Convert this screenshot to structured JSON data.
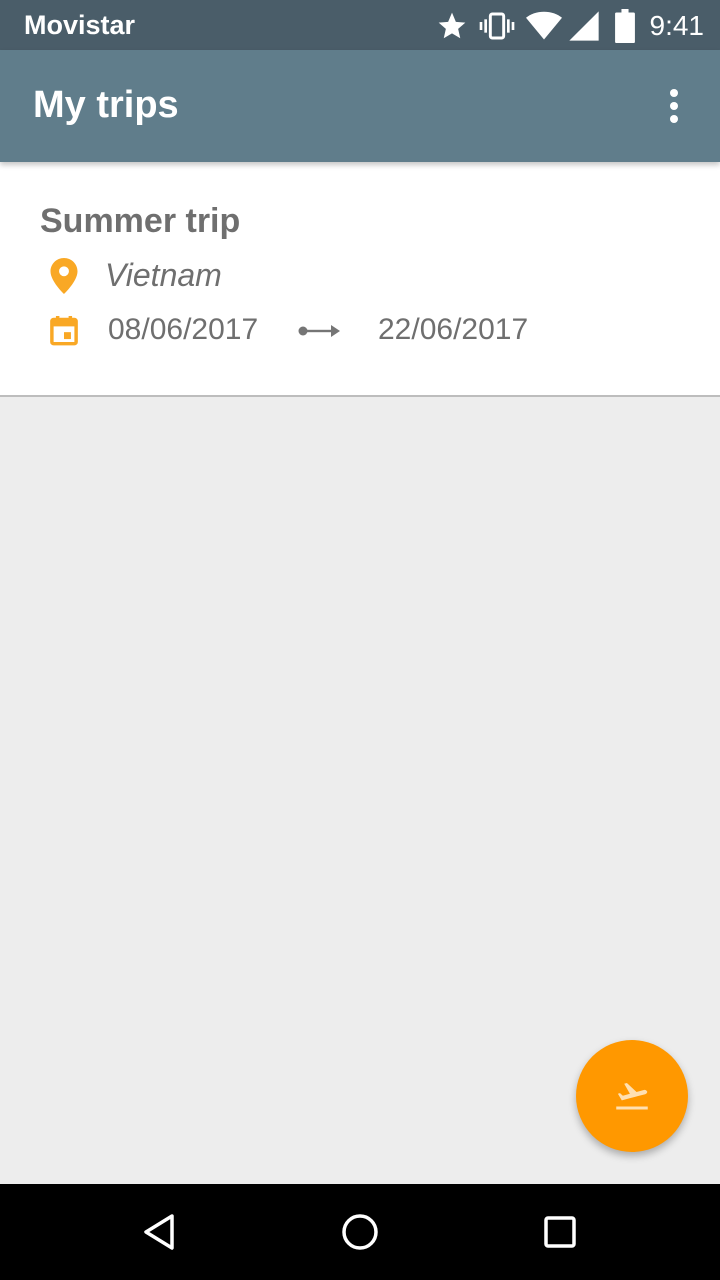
{
  "status_bar": {
    "carrier": "Movistar",
    "time": "9:41",
    "icons": [
      "star-icon",
      "vibrate-icon",
      "wifi-icon",
      "signal-icon",
      "battery-icon"
    ]
  },
  "app_bar": {
    "title": "My trips",
    "overflow_icon": "more-vert-icon"
  },
  "trips": [
    {
      "name": "Summer trip",
      "location": "Vietnam",
      "start_date": "08/06/2017",
      "end_date": "22/06/2017"
    }
  ],
  "fab": {
    "icon": "flight-takeoff-icon"
  },
  "nav_bar": {
    "buttons": [
      "back-icon",
      "home-icon",
      "recents-icon"
    ]
  },
  "colors": {
    "status_bar": "#4a5d69",
    "app_bar": "#607d8b",
    "accent": "#ff9800",
    "icon_accent": "#f9a825",
    "text": "#6f6f6f",
    "background": "#ededed"
  }
}
